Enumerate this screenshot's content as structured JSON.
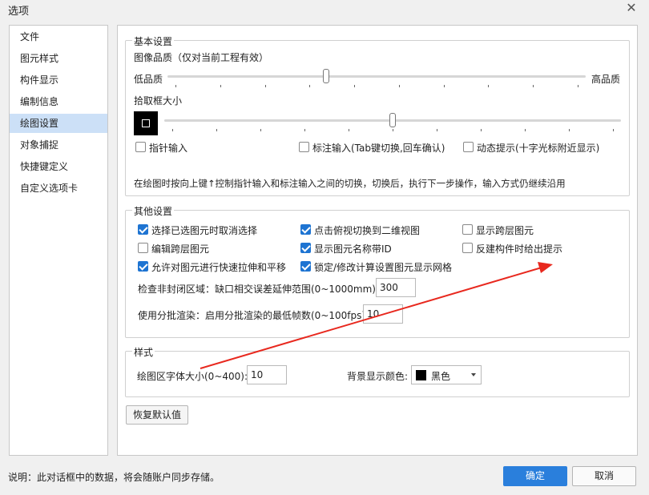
{
  "window": {
    "title": "选项",
    "close_glyph": "✕"
  },
  "nav": {
    "items": [
      {
        "label": "文件"
      },
      {
        "label": "图元样式"
      },
      {
        "label": "构件显示"
      },
      {
        "label": "编制信息"
      },
      {
        "label": "绘图设置",
        "active": true
      },
      {
        "label": "对象捕捉"
      },
      {
        "label": "快捷键定义"
      },
      {
        "label": "自定义选项卡"
      }
    ]
  },
  "basic": {
    "legend": "基本设置",
    "image_quality": {
      "label": "图像品质（仅对当前工程有效）",
      "low": "低品质",
      "high": "高品质",
      "value_fraction": 0.38
    },
    "pick_box": {
      "label": "拾取框大小",
      "value_fraction": 0.5
    },
    "checkboxes": [
      {
        "label": "指针输入",
        "checked": false
      },
      {
        "label": "标注输入(Tab键切换,回车确认)",
        "checked": false
      },
      {
        "label": "动态提示(十字光标附近显示)",
        "checked": false
      }
    ],
    "hint": "在绘图时按向上键↑控制指针输入和标注输入之间的切换，切换后，执行下一步操作，输入方式仍继续沿用"
  },
  "other": {
    "legend": "其他设置",
    "checkboxes": [
      {
        "label": "选择已选图元时取消选择",
        "checked": true
      },
      {
        "label": "点击俯视切换到二维视图",
        "checked": true
      },
      {
        "label": "显示跨层图元",
        "checked": false
      },
      {
        "label": "编辑跨层图元",
        "checked": false
      },
      {
        "label": "显示图元名称带ID",
        "checked": true
      },
      {
        "label": "反建构件时给出提示",
        "checked": false
      },
      {
        "label": "允许对图元进行快速拉伸和平移",
        "checked": true
      },
      {
        "label": "锁定/修改计算设置图元显示网格",
        "checked": true
      }
    ],
    "gap_check": {
      "label": "检查非封闭区域：缺口相交误差延伸范围(0~1000mm):",
      "value": "300"
    },
    "batch_render": {
      "label": "使用分批渲染：启用分批渲染的最低帧数(0~100fps):",
      "value": "10"
    }
  },
  "style": {
    "legend": "样式",
    "font_size": {
      "label": "绘图区字体大小(0~400):",
      "value": "10"
    },
    "bg_color": {
      "label": "背景显示颜色:",
      "value": "黑色",
      "swatch": "#000000"
    }
  },
  "restore_label": "恢复默认值",
  "footer": {
    "note": "说明：此对话框中的数据，将会随账户同步存储。",
    "ok": "确定",
    "cancel": "取消"
  },
  "annotation": {
    "type": "arrow",
    "color": "#e8281e"
  }
}
